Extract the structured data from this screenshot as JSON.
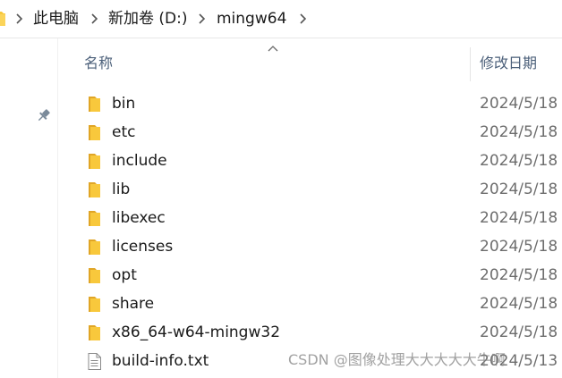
{
  "breadcrumb": {
    "items": [
      "此电脑",
      "新加卷 (D:)",
      "mingw64"
    ]
  },
  "columns": {
    "name_label": "名称",
    "date_label": "修改日期",
    "sort": "name-ascending"
  },
  "files": [
    {
      "name": "bin",
      "date": "2024/5/18",
      "type": "folder"
    },
    {
      "name": "etc",
      "date": "2024/5/18",
      "type": "folder"
    },
    {
      "name": "include",
      "date": "2024/5/18",
      "type": "folder"
    },
    {
      "name": "lib",
      "date": "2024/5/18",
      "type": "folder"
    },
    {
      "name": "libexec",
      "date": "2024/5/18",
      "type": "folder"
    },
    {
      "name": "licenses",
      "date": "2024/5/18",
      "type": "folder"
    },
    {
      "name": "opt",
      "date": "2024/5/18",
      "type": "folder"
    },
    {
      "name": "share",
      "date": "2024/5/18",
      "type": "folder"
    },
    {
      "name": "x86_64-w64-mingw32",
      "date": "2024/5/18",
      "type": "folder"
    },
    {
      "name": "build-info.txt",
      "date": "2024/5/13",
      "type": "text-file"
    }
  ],
  "watermark": "CSDN @图像处理大大大大大牛啊",
  "colors": {
    "folder_yellow": "#f8c83c",
    "folder_dark": "#e0a526",
    "header_text": "#4c607a",
    "date_text": "#6d6d6d"
  },
  "icons": {
    "breadcrumb_root": "folder-icon",
    "separator": "chevron-right-icon",
    "pin": "pin-icon",
    "sort": "sort-ascending-icon",
    "folder": "folder-icon",
    "text_file": "text-file-icon"
  }
}
